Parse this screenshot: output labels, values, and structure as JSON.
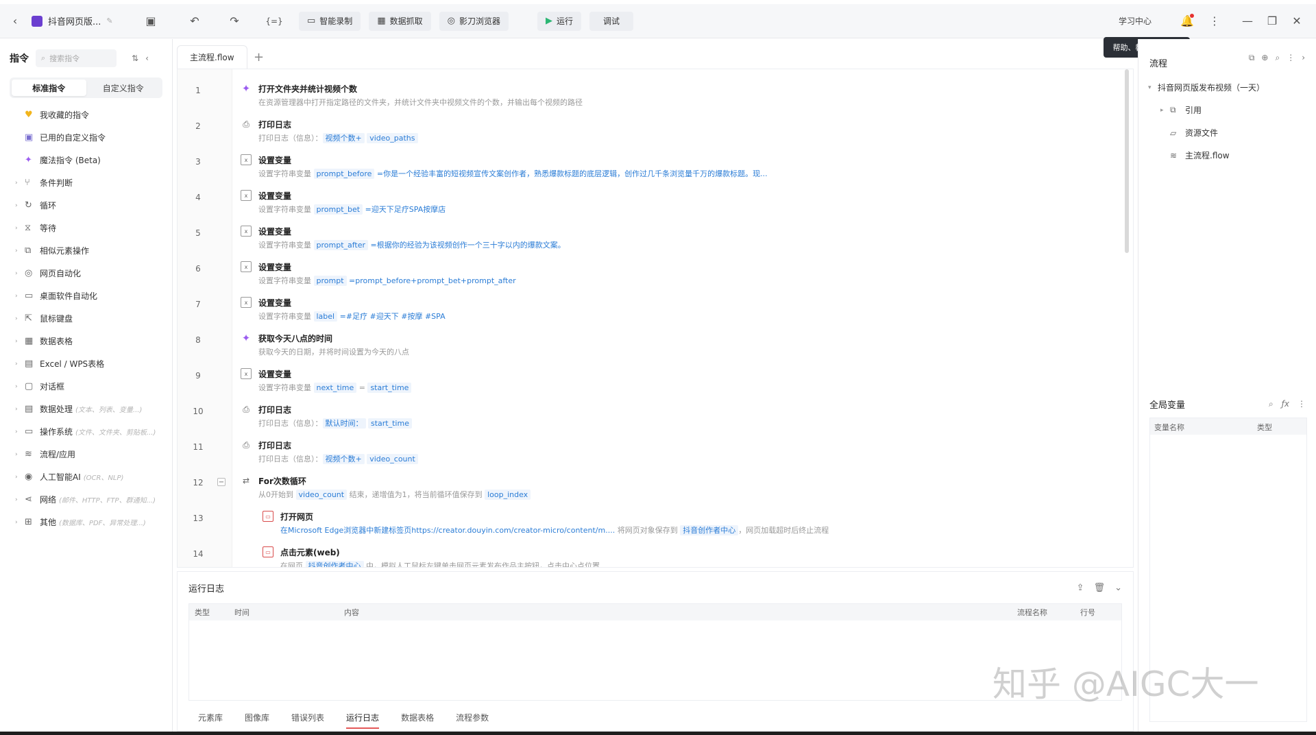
{
  "toolbar": {
    "title": "抖音网页版...",
    "buttons": {
      "record": "智能录制",
      "capture": "数据抓取",
      "browser": "影刀浏览器",
      "run": "运行",
      "debug": "调试"
    },
    "learn_center": "学习中心",
    "tooltip": "帮助、教程、学影刀"
  },
  "left_panel": {
    "title": "指令",
    "search_placeholder": "搜索指令",
    "tabs": [
      "标准指令",
      "自定义指令"
    ],
    "pinned": [
      {
        "label": "我收藏的指令",
        "icon": "heart-icon"
      },
      {
        "label": "已用的自定义指令",
        "icon": "custom-icon"
      },
      {
        "label": "魔法指令 (Beta)",
        "icon": "magic-icon"
      }
    ],
    "categories": [
      {
        "label": "条件判断",
        "sub": ""
      },
      {
        "label": "循环",
        "sub": ""
      },
      {
        "label": "等待",
        "sub": ""
      },
      {
        "label": "相似元素操作",
        "sub": ""
      },
      {
        "label": "网页自动化",
        "sub": ""
      },
      {
        "label": "桌面软件自动化",
        "sub": ""
      },
      {
        "label": "鼠标键盘",
        "sub": ""
      },
      {
        "label": "数据表格",
        "sub": ""
      },
      {
        "label": "Excel / WPS表格",
        "sub": ""
      },
      {
        "label": "对话框",
        "sub": ""
      },
      {
        "label": "数据处理",
        "sub": "(文本、列表、变量...)"
      },
      {
        "label": "操作系统",
        "sub": "(文件、文件夹、剪贴板...)"
      },
      {
        "label": "流程/应用",
        "sub": ""
      },
      {
        "label": "人工智能AI",
        "sub": "(OCR、NLP)"
      },
      {
        "label": "网络",
        "sub": "(邮件、HTTP、FTP、群通知...)"
      },
      {
        "label": "其他",
        "sub": "(数据库、PDF、异常处理...)"
      }
    ]
  },
  "editor": {
    "tab": "主流程.flow",
    "lines": [
      "1",
      "2",
      "3",
      "4",
      "5",
      "6",
      "7",
      "8",
      "9",
      "10",
      "11",
      "12",
      "13",
      "14"
    ],
    "steps": [
      {
        "title": "打开文件夹并统计视频个数",
        "desc": "在资源管理器中打开指定路径的文件夹，并统计文件夹中视频文件的个数，并输出每个视频的路径"
      },
      {
        "title": "打印日志",
        "desc_pre": "打印日志（信息）：",
        "tag1": "视频个数+",
        "tag2": "video_paths"
      },
      {
        "title": "设置变量",
        "desc_pre": "设置字符串变量",
        "var": "prompt_before",
        "value": "=你是一个经验丰富的短视频宣传文案创作者，熟悉爆款标题的底层逻辑，创作过几千条浏览量千万的爆款标题。现..."
      },
      {
        "title": "设置变量",
        "desc_pre": "设置字符串变量",
        "var": "prompt_bet",
        "value": "=迎天下足疗SPA按摩店"
      },
      {
        "title": "设置变量",
        "desc_pre": "设置字符串变量",
        "var": "prompt_after",
        "value": "=根据你的经验为该视频创作一个三十字以内的爆款文案。"
      },
      {
        "title": "设置变量",
        "desc_pre": "设置字符串变量",
        "var": "prompt",
        "value": "=prompt_before+prompt_bet+prompt_after"
      },
      {
        "title": "设置变量",
        "desc_pre": "设置字符串变量",
        "var": "label",
        "value": "=#足疗 #迎天下 #按摩 #SPA"
      },
      {
        "title": "获取今天八点的时间",
        "desc": "获取今天的日期，并将时间设置为今天的八点"
      },
      {
        "title": "设置变量",
        "desc_pre": "设置字符串变量",
        "var": "next_time",
        "eq": "=",
        "value_tag": "start_time"
      },
      {
        "title": "打印日志",
        "desc_pre": "打印日志（信息）：",
        "tag1": "默认时间：",
        "tag2": "start_time"
      },
      {
        "title": "打印日志",
        "desc_pre": "打印日志（信息）：",
        "tag1": "视频个数+",
        "tag2": "video_count"
      },
      {
        "title": "For次数循环",
        "d1": "从0开始到",
        "var": "video_count",
        "d2": "结束，递增值为1，将当前循环值保存到",
        "var2": "loop_index"
      },
      {
        "title": "打开网页",
        "d1": "在Microsoft Edge浏览器中新建标签页https://creator.douyin.com/creator-micro/content/m....",
        "d2": "将网页对象保存到",
        "tag": "抖音创作者中心",
        "d3": "，网页加载超时后终止流程"
      },
      {
        "title": "点击元素(web)",
        "d1": "在网页",
        "tag": "抖音创作者中心",
        "d2": "中，模拟人工鼠标左键单击网页元素发布作品主按钮，点击中心点位置"
      }
    ]
  },
  "log_panel": {
    "title": "运行日志",
    "columns": [
      "类型",
      "时间",
      "内容",
      "流程名称",
      "行号"
    ],
    "tabs": [
      "元素库",
      "图像库",
      "错误列表",
      "运行日志",
      "数据表格",
      "流程参数"
    ],
    "active_tab": "运行日志"
  },
  "right_panel": {
    "title": "流程",
    "tree": [
      {
        "label": "抖音网页版发布视频（一天）",
        "icon": "chevron-down-icon"
      },
      {
        "label": "引用",
        "icon": "ref-icon"
      },
      {
        "label": "资源文件",
        "icon": "folder-icon"
      },
      {
        "label": "主流程.flow",
        "icon": "layers-icon"
      }
    ],
    "globals": {
      "title": "全局变量",
      "columns": [
        "变量名称",
        "类型"
      ]
    }
  },
  "watermark": "知乎 @AIGC大一",
  "colors": {
    "accent": "#2a7cd6",
    "magic": "#9b5cf0",
    "logo": "#6b3fd0",
    "active_underline": "#e45757"
  }
}
